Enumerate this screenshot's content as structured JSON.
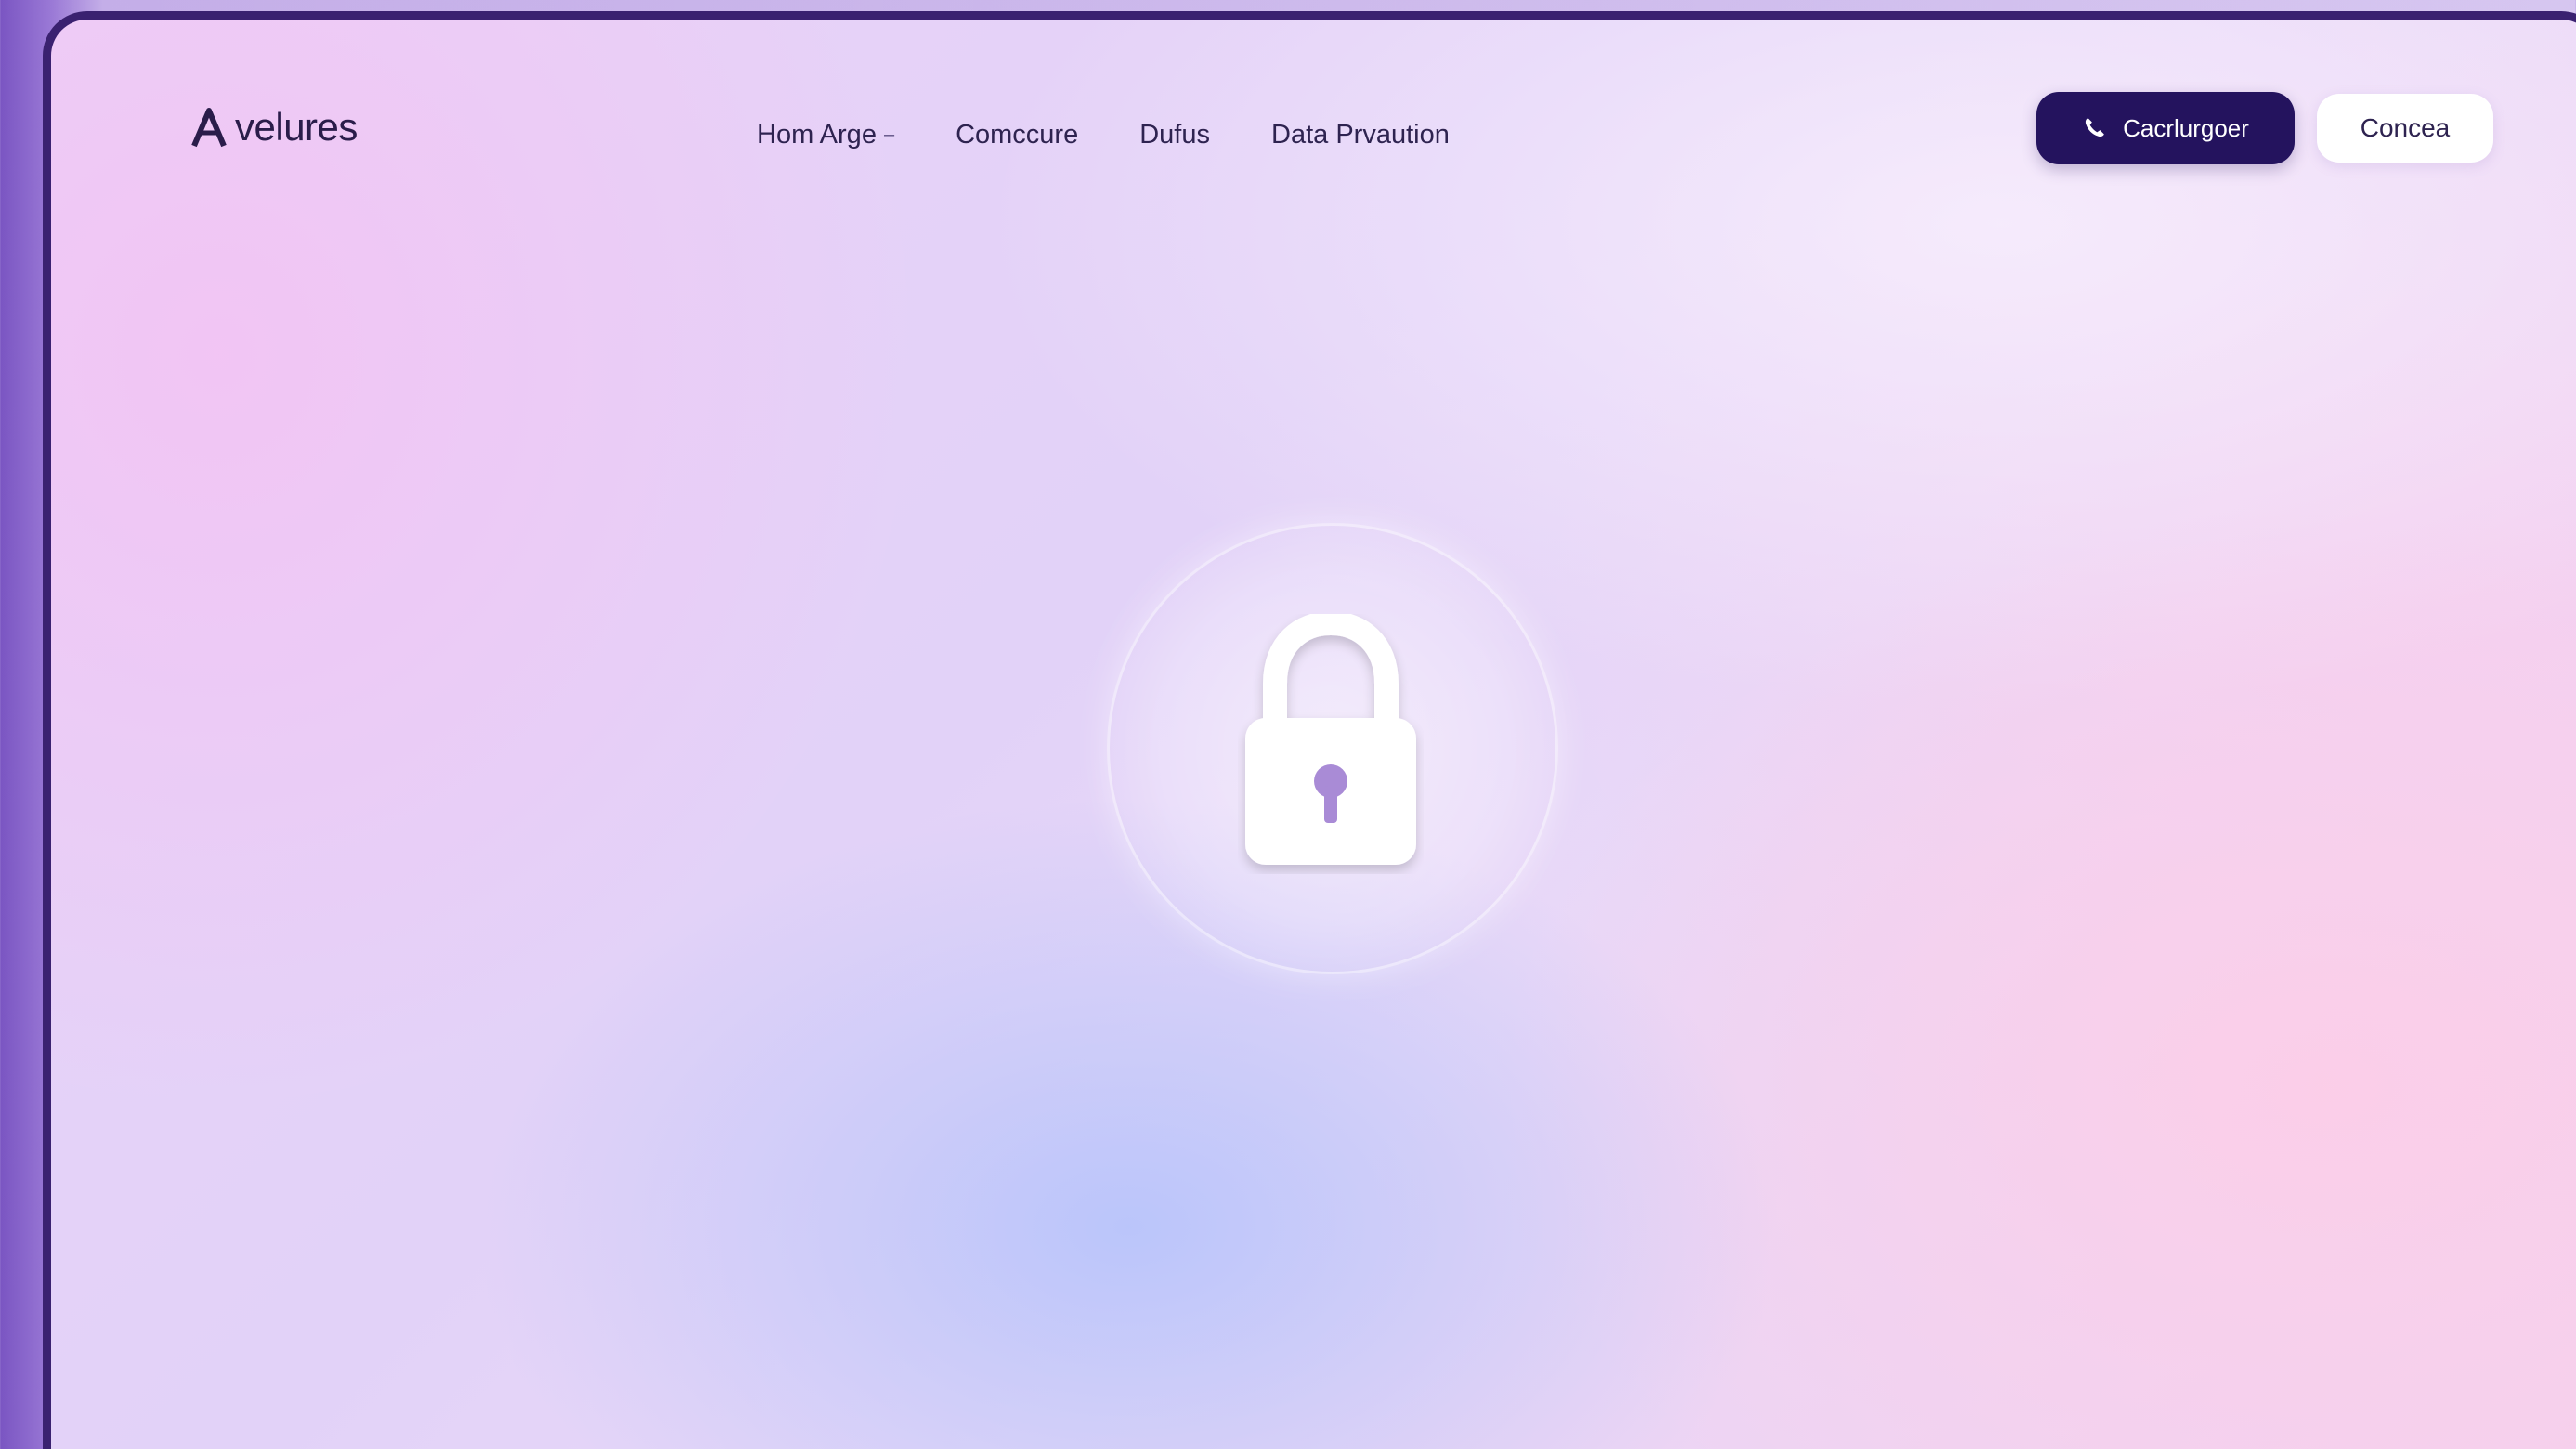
{
  "brand": {
    "name": "velures",
    "logo_icon": "logo-a-mark"
  },
  "nav": {
    "items": [
      {
        "label": "Hom Arge",
        "has_dropdown": true
      },
      {
        "label": "Comccure",
        "has_dropdown": false
      },
      {
        "label": "Dufus",
        "has_dropdown": false
      },
      {
        "label": "Data Prvaution",
        "has_dropdown": false
      }
    ]
  },
  "actions": {
    "primary_label": "Cacrlurgoer",
    "primary_icon": "phone-icon",
    "secondary_label": "Concea"
  },
  "hero": {
    "icon": "lock-icon"
  },
  "colors": {
    "primary_button": "#24135e",
    "frame_border": "#3a2170",
    "background_tint": "#e2d2f8"
  }
}
